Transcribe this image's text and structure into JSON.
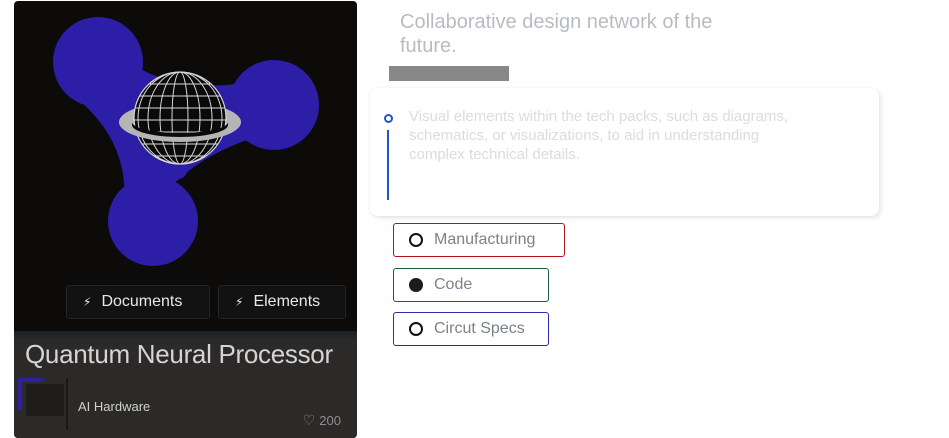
{
  "card": {
    "title": "Quantum Neural Processor",
    "category": "AI Hardware",
    "likes": "200",
    "chips": [
      {
        "label": "Documents",
        "icon": "lightning-icon"
      },
      {
        "label": "Elements",
        "icon": "lightning-icon"
      }
    ],
    "colors": {
      "accent": "#2c1ea6",
      "background": "#0c0b0a"
    }
  },
  "panel": {
    "headline": "Collaborative design network of the future.",
    "info_text": "Visual elements within the tech packs, such as diagrams, schematics, or visualizations, to aid in understanding complex technical details."
  },
  "options": [
    {
      "label": "Manufacturing",
      "checked": false,
      "border": "#b3141f"
    },
    {
      "label": "Code",
      "checked": true,
      "border": "#1d5e3a"
    },
    {
      "label": "Circut Specs",
      "checked": false,
      "border": "#2c2ab0"
    }
  ]
}
